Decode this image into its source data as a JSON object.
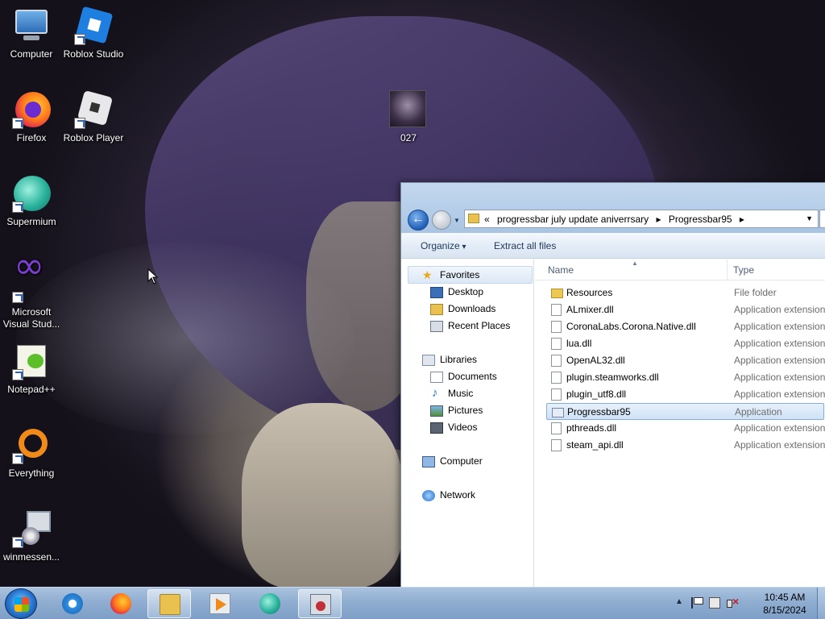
{
  "desktop": {
    "icons": [
      {
        "label": "Computer",
        "icon": "computer-icon"
      },
      {
        "label": "Roblox Studio",
        "icon": "roblox-studio-icon"
      },
      {
        "label": "Firefox",
        "icon": "firefox-icon"
      },
      {
        "label": "Roblox Player",
        "icon": "roblox-player-icon"
      },
      {
        "label": "027",
        "icon": "image-thumbnail-icon"
      },
      {
        "label": "Supermium",
        "icon": "supermium-icon"
      },
      {
        "label": "Microsoft Visual Stud...",
        "icon": "visual-studio-icon"
      },
      {
        "label": "Notepad++",
        "icon": "notepad-plus-plus-icon"
      },
      {
        "label": "Everything",
        "icon": "everything-search-icon"
      },
      {
        "label": "winmessen...",
        "icon": "winmessenger-icon"
      }
    ]
  },
  "explorer": {
    "address": {
      "overflow": "«",
      "segments": [
        "progressbar july update aniverrsary",
        "Progressbar95"
      ],
      "separator": "▸"
    },
    "toolbar": {
      "organize": "Organize",
      "extract": "Extract all files"
    },
    "nav_pane": {
      "favorites": "Favorites",
      "favorites_items": [
        "Desktop",
        "Downloads",
        "Recent Places"
      ],
      "libraries": "Libraries",
      "libraries_items": [
        "Documents",
        "Music",
        "Pictures",
        "Videos"
      ],
      "computer": "Computer",
      "network": "Network"
    },
    "columns": {
      "name": "Name",
      "type": "Type"
    },
    "files": [
      {
        "name": "Resources",
        "type": "File folder",
        "kind": "folder"
      },
      {
        "name": "ALmixer.dll",
        "type": "Application extension",
        "kind": "dll"
      },
      {
        "name": "CoronaLabs.Corona.Native.dll",
        "type": "Application extension",
        "kind": "dll"
      },
      {
        "name": "lua.dll",
        "type": "Application extension",
        "kind": "dll"
      },
      {
        "name": "OpenAL32.dll",
        "type": "Application extension",
        "kind": "dll"
      },
      {
        "name": "plugin.steamworks.dll",
        "type": "Application extension",
        "kind": "dll"
      },
      {
        "name": "plugin_utf8.dll",
        "type": "Application extension",
        "kind": "dll"
      },
      {
        "name": "Progressbar95",
        "type": "Application",
        "kind": "app",
        "selected": true
      },
      {
        "name": "pthreads.dll",
        "type": "Application extension",
        "kind": "dll"
      },
      {
        "name": "steam_api.dll",
        "type": "Application extension",
        "kind": "dll"
      }
    ]
  },
  "taskbar": {
    "apps": [
      {
        "icon": "internet-explorer-icon",
        "active": false
      },
      {
        "icon": "firefox-icon",
        "active": false
      },
      {
        "icon": "file-explorer-icon",
        "active": true
      },
      {
        "icon": "media-player-icon",
        "active": false
      },
      {
        "icon": "supermium-icon",
        "active": false
      },
      {
        "icon": "winmessenger-icon",
        "active": true
      }
    ],
    "clock": {
      "time": "10:45 AM",
      "date": "8/15/2024"
    },
    "tray_arrow": "▲"
  }
}
